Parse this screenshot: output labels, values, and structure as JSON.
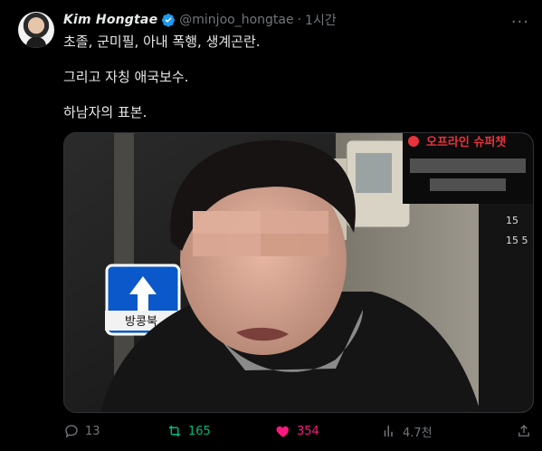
{
  "author": {
    "display_name": "Kim Hongtae",
    "handle": "@minjoo_hongtae",
    "separator": "·",
    "time": "1시간"
  },
  "tweet": {
    "lines": [
      "초졸, 군미필, 아내 폭행, 생계곤란.",
      "그리고 자칭 애국보수.",
      "하남자의 표본."
    ]
  },
  "media": {
    "overlay_title": "오프라인 슈퍼챗",
    "sign_text": "방콩북",
    "side_text_1": "15",
    "side_text_2": "15 5"
  },
  "actions": {
    "replies": "13",
    "retweets": "165",
    "likes": "354",
    "views": "4.7천"
  },
  "colors": {
    "retweet": "#00ba7c",
    "like": "#f91880",
    "muted": "#71767b",
    "verified": "#1d9bf0"
  }
}
